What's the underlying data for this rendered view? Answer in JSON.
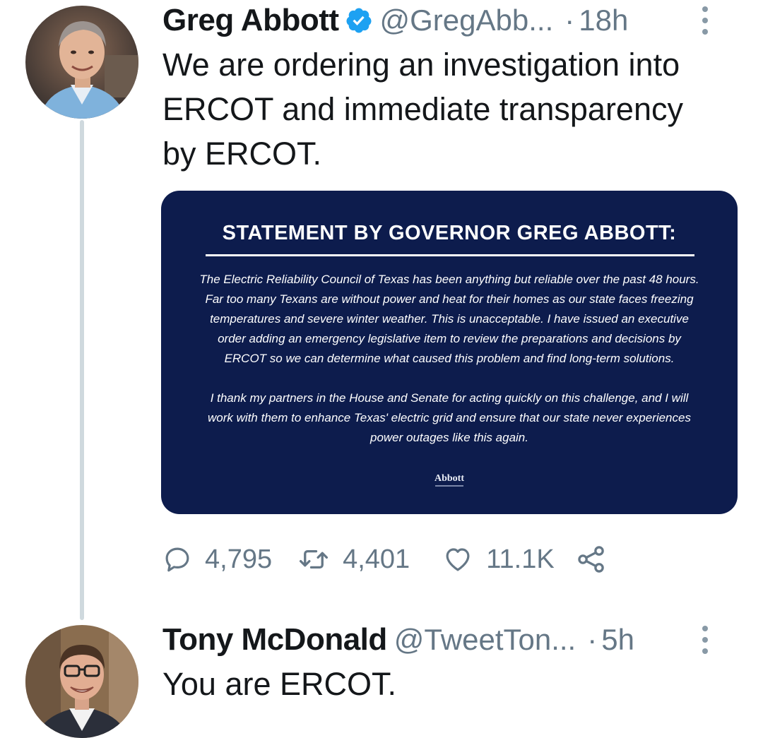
{
  "tweets": [
    {
      "display_name": "Greg Abbott",
      "verified": true,
      "handle": "@GregAbb...",
      "separator": "·",
      "time": "18h",
      "text": "We are ordering an investigation into\nERCOT and immediate transparency\nby ERCOT.",
      "attachment": {
        "title": "STATEMENT BY GOVERNOR GREG ABBOTT:",
        "paragraphs": [
          "The Electric Reliability Council of Texas has been anything but reliable over the past 48 hours. Far too many Texans are without power and heat for their homes as our state faces freezing temperatures and severe winter weather. This is unacceptable. I have issued an executive order adding an emergency legislative item to review the preparations and decisions by ERCOT so we can determine what caused this problem and find long-term solutions.",
          "I thank my partners in the House and Senate for acting quickly on this challenge, and I will work with them to enhance Texas' electric grid and ensure that our state never experiences power outages like this again."
        ],
        "signature": "Abbott"
      },
      "actions": {
        "reply_count": "4,795",
        "retweet_count": "4,401",
        "like_count": "11.1K"
      }
    },
    {
      "display_name": "Tony McDonald",
      "verified": false,
      "handle": "@TweetTon...",
      "separator": "·",
      "time": "5h",
      "text": "You are ERCOT."
    }
  ],
  "colors": {
    "verified_badge": "#1da1f2",
    "secondary_text": "#657786",
    "card_background": "#0d1c4d",
    "thread_line": "#cfd9de"
  },
  "icons": [
    "verified-icon",
    "more-options-icon",
    "reply-icon",
    "retweet-icon",
    "like-icon",
    "share-icon"
  ]
}
